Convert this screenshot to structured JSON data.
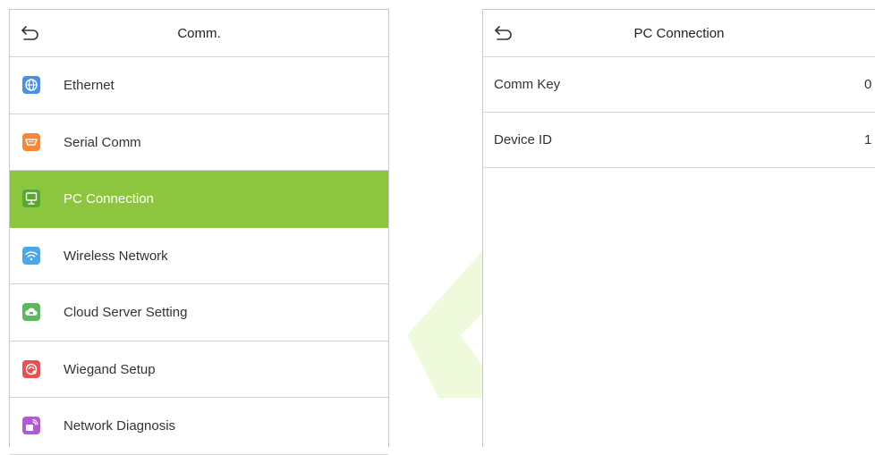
{
  "left_screen": {
    "title": "Comm.",
    "items": [
      {
        "label": "Ethernet",
        "icon": "globe-icon",
        "color": "#4a90e2"
      },
      {
        "label": "Serial Comm",
        "icon": "serial-port-icon",
        "color": "#f5883a"
      },
      {
        "label": "PC Connection",
        "icon": "computer-icon",
        "color": "#5aa534",
        "active": true
      },
      {
        "label": "Wireless Network",
        "icon": "wifi-icon",
        "color": "#4aa8e8"
      },
      {
        "label": "Cloud Server Setting",
        "icon": "cloud-icon",
        "color": "#5cb85c"
      },
      {
        "label": "Wiegand Setup",
        "icon": "wiegand-icon",
        "color": "#e8504f"
      },
      {
        "label": "Network Diagnosis",
        "icon": "network-diagnosis-icon",
        "color": "#b05cd0"
      }
    ]
  },
  "right_screen": {
    "title": "PC Connection",
    "rows": [
      {
        "label": "Comm Key",
        "value": "0"
      },
      {
        "label": "Device ID",
        "value": "1"
      }
    ]
  },
  "colors": {
    "accent": "#8cc63f",
    "divider": "#d4d4d4",
    "watermark": "#ecf9d6"
  }
}
